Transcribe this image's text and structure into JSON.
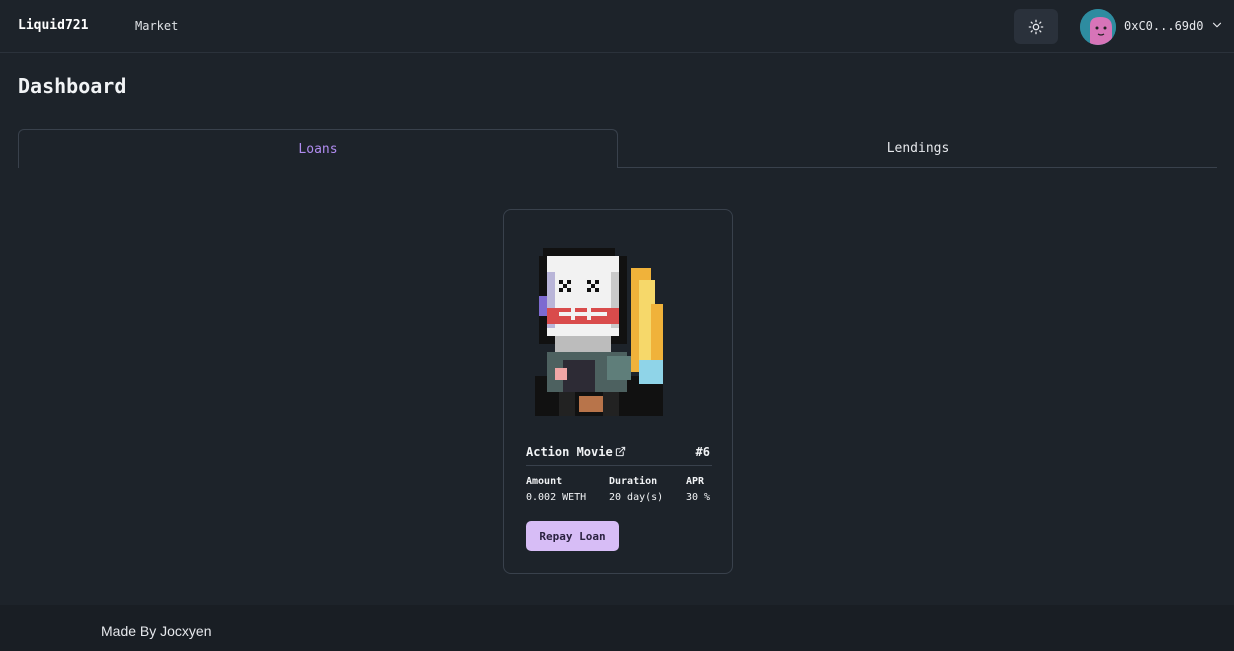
{
  "navbar": {
    "brand": "Liquid721",
    "links": [
      "Market"
    ],
    "theme_icon": "sun-icon",
    "wallet_address": "0xC0...69d0",
    "wallet_menu_icon": "chevron-down-icon"
  },
  "page": {
    "title": "Dashboard"
  },
  "tabs": [
    {
      "label": "Loans",
      "active": true
    },
    {
      "label": "Lendings",
      "active": false
    }
  ],
  "loan_card": {
    "name": "Action Movie",
    "link_icon": "external-link-icon",
    "token_id": "#6",
    "stats": [
      {
        "label": "Amount",
        "value": "0.002 WETH"
      },
      {
        "label": "Duration",
        "value": "20 day(s)"
      },
      {
        "label": "APR",
        "value": "30 %"
      }
    ],
    "action_label": "Repay Loan"
  },
  "footer": {
    "text": "Made By Jocxyen"
  },
  "colors": {
    "background": "#1d232a",
    "accent": "#b08cf0",
    "button": "#d7bdf6",
    "footer": "#191e24"
  }
}
